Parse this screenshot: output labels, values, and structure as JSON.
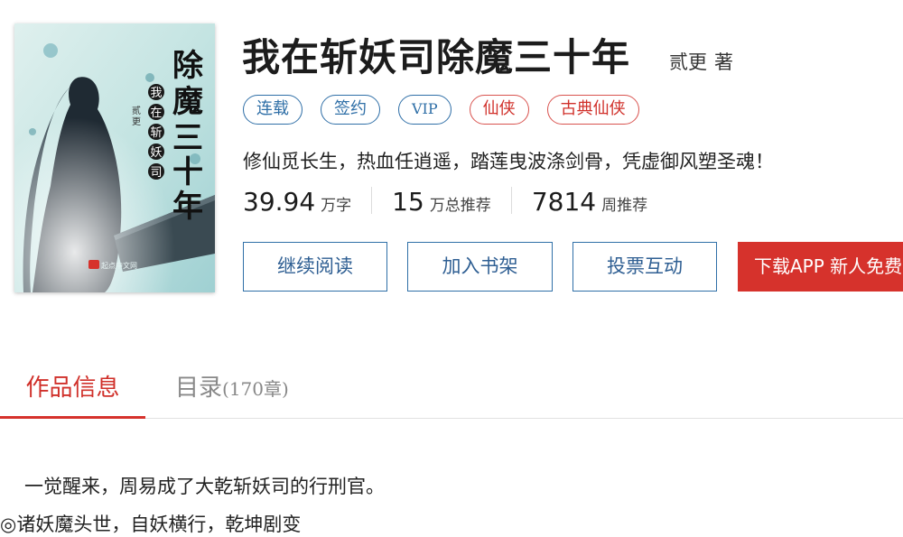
{
  "book": {
    "title": "我在斩妖司除魔三十年",
    "author": "贰更",
    "author_suffix": "著",
    "intro": "修仙觅长生，热血任逍遥，踏莲曳波涤剑骨，凭虚御风塑圣魂！",
    "cover": {
      "title_text": "除魔三十年",
      "subtitle_text": "我在斩妖司",
      "author_text": "贰更",
      "publisher_text": "起点中文网"
    }
  },
  "tags": [
    "连载",
    "签约",
    "VIP",
    "仙侠",
    "古典仙侠"
  ],
  "stats": [
    {
      "value": "39.94",
      "unit": "万字"
    },
    {
      "value": "15",
      "unit": "万总推荐"
    },
    {
      "value": "7814",
      "unit": "周推荐"
    }
  ],
  "buttons": {
    "read": "继续阅读",
    "shelf": "加入书架",
    "vote": "投票互动",
    "app": "下载APP 新人免费"
  },
  "tabs": {
    "info": "作品信息",
    "toc": "目录",
    "toc_count": "(170章)"
  },
  "description": {
    "line1": "一觉醒来，周易成了大乾斩妖司的行刑官。",
    "line2": "◎诸妖魔头世，自妖横行，乾坤剧变"
  },
  "colors": {
    "accent_red": "#d6322c",
    "link_blue": "#2f6fa7"
  }
}
